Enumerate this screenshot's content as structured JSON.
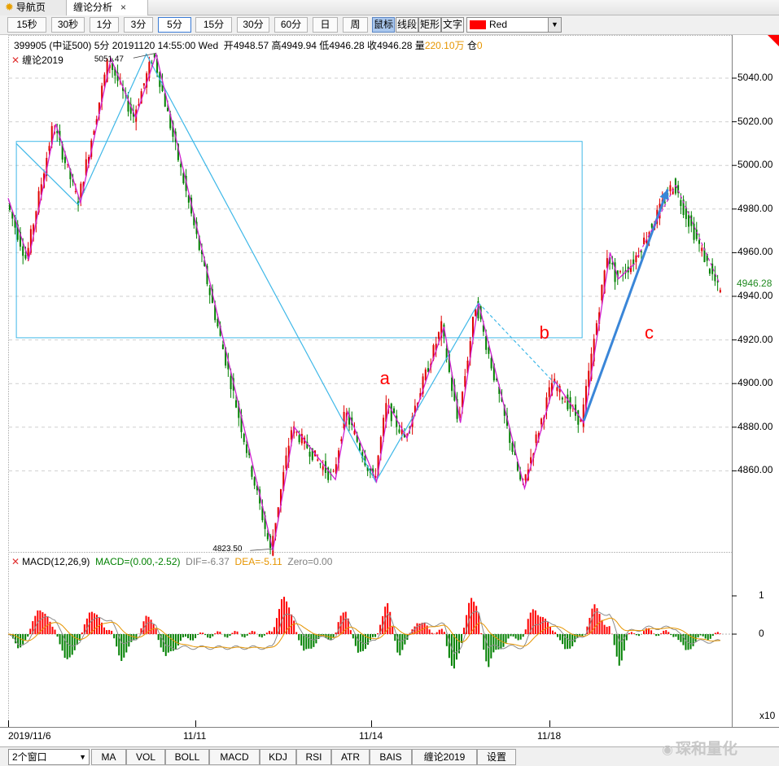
{
  "tabs": {
    "home_label": "导航页",
    "analysis_label": "缠论分析",
    "close_glyph": "×"
  },
  "toolbar": {
    "periods": [
      "15秒",
      "30秒",
      "1分",
      "3分",
      "5分",
      "15分",
      "30分",
      "60分",
      "日",
      "周"
    ],
    "active_period": "5分",
    "tools": [
      "鼠标",
      "线段",
      "矩形",
      "文字"
    ],
    "active_tool": "鼠标",
    "color_name": "Red",
    "color_value": "#ff0000"
  },
  "info": {
    "code": "399905",
    "name": "(中证500)",
    "period": "5分",
    "datetime": "20191120 14:55:00 Wed",
    "open_label": "开",
    "open": "4948.57",
    "high_label": "高",
    "high": "4949.94",
    "low_label": "低",
    "low": "4946.28",
    "close_label": "收",
    "close": "4946.28",
    "volume_label": "量",
    "volume": "220.10万",
    "position_label": "仓",
    "position": "0"
  },
  "chan_indicator": {
    "label": "缠论2019"
  },
  "macd_indicator": {
    "title": "MACD(12,26,9)",
    "macd_text": "MACD=(0.00,-2.52)",
    "dif_text": "DIF=-6.37",
    "dea_text": "DEA=-5.11",
    "zero_text": "Zero=0.00"
  },
  "current_price_label": "4946.28",
  "macd_scale_label": "x10",
  "wave_labels": [
    "a",
    "b",
    "c"
  ],
  "watermark": "琛和量化",
  "chart_data": {
    "type": "candlestick",
    "symbol": "399905",
    "y_ticks": [
      5040,
      5020,
      5000,
      4980,
      4960,
      4940,
      4920,
      4900,
      4880,
      4860
    ],
    "y_range": [
      4822,
      5059
    ],
    "x_tick_labels": [
      "2019/11/6",
      "11/11",
      "11/14",
      "11/18"
    ],
    "high_annotation": {
      "label": "5051.47",
      "value": 5051.47
    },
    "low_annotation": {
      "label": "4823.50",
      "value": 4823.5
    },
    "bi_path_magenta": [
      {
        "i": 0,
        "p": 4985
      },
      {
        "i": 25,
        "p": 4957
      },
      {
        "i": 58,
        "p": 5019
      },
      {
        "i": 88,
        "p": 4983
      },
      {
        "i": 125,
        "p": 5049
      },
      {
        "i": 155,
        "p": 5022
      },
      {
        "i": 180,
        "p": 5051
      },
      {
        "i": 322,
        "p": 4823.5
      },
      {
        "i": 348,
        "p": 4880
      },
      {
        "i": 398,
        "p": 4856
      },
      {
        "i": 413,
        "p": 4887
      },
      {
        "i": 448,
        "p": 4855
      },
      {
        "i": 463,
        "p": 4890
      },
      {
        "i": 485,
        "p": 4875
      },
      {
        "i": 530,
        "p": 4926
      },
      {
        "i": 550,
        "p": 4882
      },
      {
        "i": 572,
        "p": 4937
      },
      {
        "i": 628,
        "p": 4852
      },
      {
        "i": 665,
        "p": 4901
      },
      {
        "i": 700,
        "p": 4882
      },
      {
        "i": 732,
        "p": 4960
      },
      {
        "i": 742,
        "p": 4948
      },
      {
        "i": 762,
        "p": 4955
      },
      {
        "i": 812,
        "p": 4992
      },
      {
        "i": 830,
        "p": 4975
      },
      {
        "i": 868,
        "p": 4942
      }
    ],
    "segment_path_cyan": [
      {
        "i": 10,
        "p": 5010
      },
      {
        "i": 85,
        "p": 4982
      },
      {
        "i": 168,
        "p": 5051
      },
      {
        "i": 447,
        "p": 4855
      },
      {
        "i": 572,
        "p": 4937
      }
    ],
    "pivot_box": {
      "i0": 10,
      "i1": 698,
      "p_high": 5011,
      "p_low": 4921
    },
    "drawn_lines": [
      {
        "kind": "dashed-cyan",
        "from": {
          "i": 572,
          "p": 4937
        },
        "to": {
          "i": 670,
          "p": 4898
        }
      },
      {
        "kind": "arrow-blue",
        "from": {
          "i": 700,
          "p": 4883
        },
        "to": {
          "i": 802,
          "p": 4989
        }
      },
      {
        "kind": "dashed-magenta",
        "from": {
          "i": 765,
          "p": 4958
        },
        "to": {
          "i": 812,
          "p": 4991
        }
      },
      {
        "kind": "dashed-magenta",
        "from": {
          "i": 812,
          "p": 4991
        },
        "to": {
          "i": 865,
          "p": 4946
        }
      }
    ],
    "wave_label_positions": [
      {
        "label": "a",
        "i": 458,
        "p": 4902
      },
      {
        "label": "b",
        "i": 652,
        "p": 4923
      },
      {
        "label": "c",
        "i": 780,
        "p": 4923
      }
    ],
    "current_price": 4946.28,
    "macd_y_ticks": [
      1,
      0
    ],
    "macd_y_tick_labels": [
      "1",
      "0"
    ]
  },
  "bottom": {
    "window_select": "2个窗口",
    "buttons": [
      "MA",
      "VOL",
      "BOLL",
      "MACD",
      "KDJ",
      "RSI",
      "ATR",
      "BAIS",
      "缠论2019",
      "设置"
    ]
  }
}
